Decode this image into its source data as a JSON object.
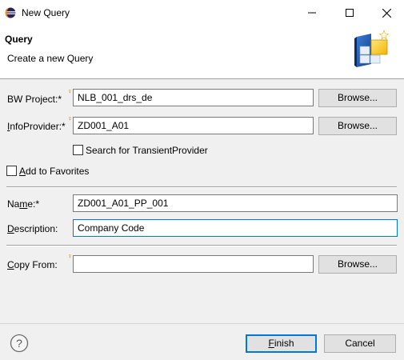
{
  "window": {
    "title": "New Query",
    "app_icon": "eclipse-icon",
    "controls": [
      "minimize-icon",
      "maximize-icon",
      "close-icon"
    ]
  },
  "banner": {
    "title": "Query",
    "description": "Create a new Query",
    "icon": "query-wizard-icon"
  },
  "form": {
    "bw_project": {
      "label_prefix": "BW Project:*",
      "value": "NLB_001_drs_de",
      "browse_label": "Browse..."
    },
    "infoprovider": {
      "label_mnemonic": "I",
      "label_rest": "nfoProvider:*",
      "value": "ZD001_A01",
      "browse_label": "Browse..."
    },
    "search_transient": {
      "label": "Search for TransientProvider",
      "checked": false
    },
    "add_to_favorites": {
      "label_mnemonic": "A",
      "label_rest": "dd to Favorites",
      "checked": false
    },
    "name": {
      "label_pre": "Na",
      "label_mnemonic": "m",
      "label_post": "e:*",
      "value": "ZD001_A01_PP_001"
    },
    "description": {
      "label_mnemonic": "D",
      "label_rest": "escription:",
      "value": "Company Code"
    },
    "copy_from": {
      "label_mnemonic": "C",
      "label_rest": "opy From:",
      "value": "",
      "browse_label": "Browse..."
    }
  },
  "footer": {
    "help_icon": "help-icon",
    "finish_mnemonic": "F",
    "finish_rest": "inish",
    "cancel_label": "Cancel"
  },
  "colors": {
    "accent": "#0078d7",
    "decoration": "#c07b00"
  }
}
